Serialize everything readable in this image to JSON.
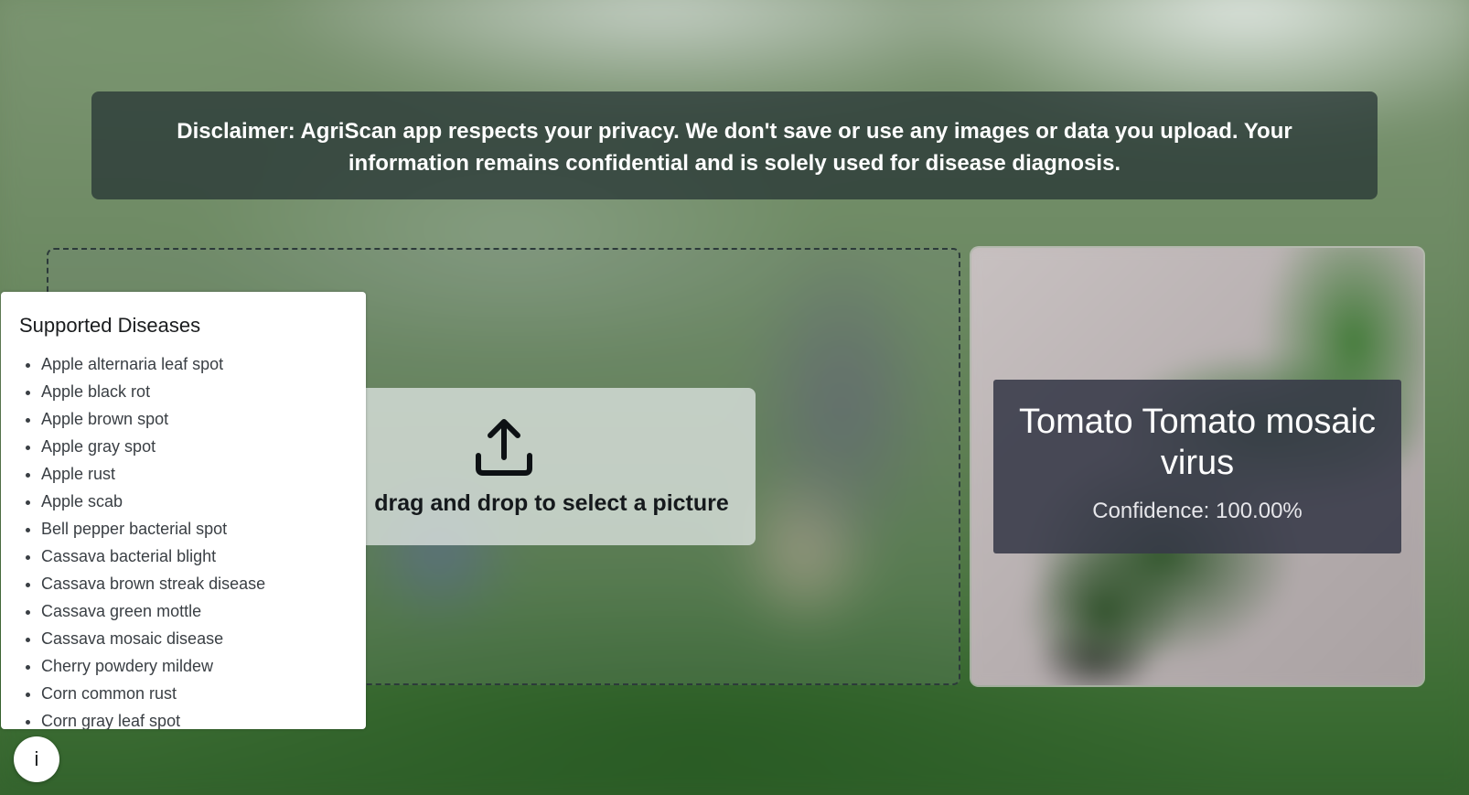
{
  "disclaimer": {
    "text": "Disclaimer: AgriScan app respects your privacy. We don't save or use any images or data you upload. Your information remains confidential and is solely used for disease diagnosis."
  },
  "upload": {
    "icon": "upload-icon",
    "label": "drag and drop to select a picture"
  },
  "result": {
    "title": "Tomato Tomato mosaic virus",
    "confidence": "Confidence: 100.00%"
  },
  "supported_diseases": {
    "title": "Supported Diseases",
    "items": [
      "Apple alternaria leaf spot",
      "Apple black rot",
      "Apple brown spot",
      "Apple gray spot",
      "Apple rust",
      "Apple scab",
      "Bell pepper bacterial spot",
      "Cassava bacterial blight",
      "Cassava brown streak disease",
      "Cassava green mottle",
      "Cassava mosaic disease",
      "Cherry powdery mildew",
      "Corn common rust",
      "Corn gray leaf spot"
    ]
  },
  "info_button": {
    "label": "i"
  }
}
